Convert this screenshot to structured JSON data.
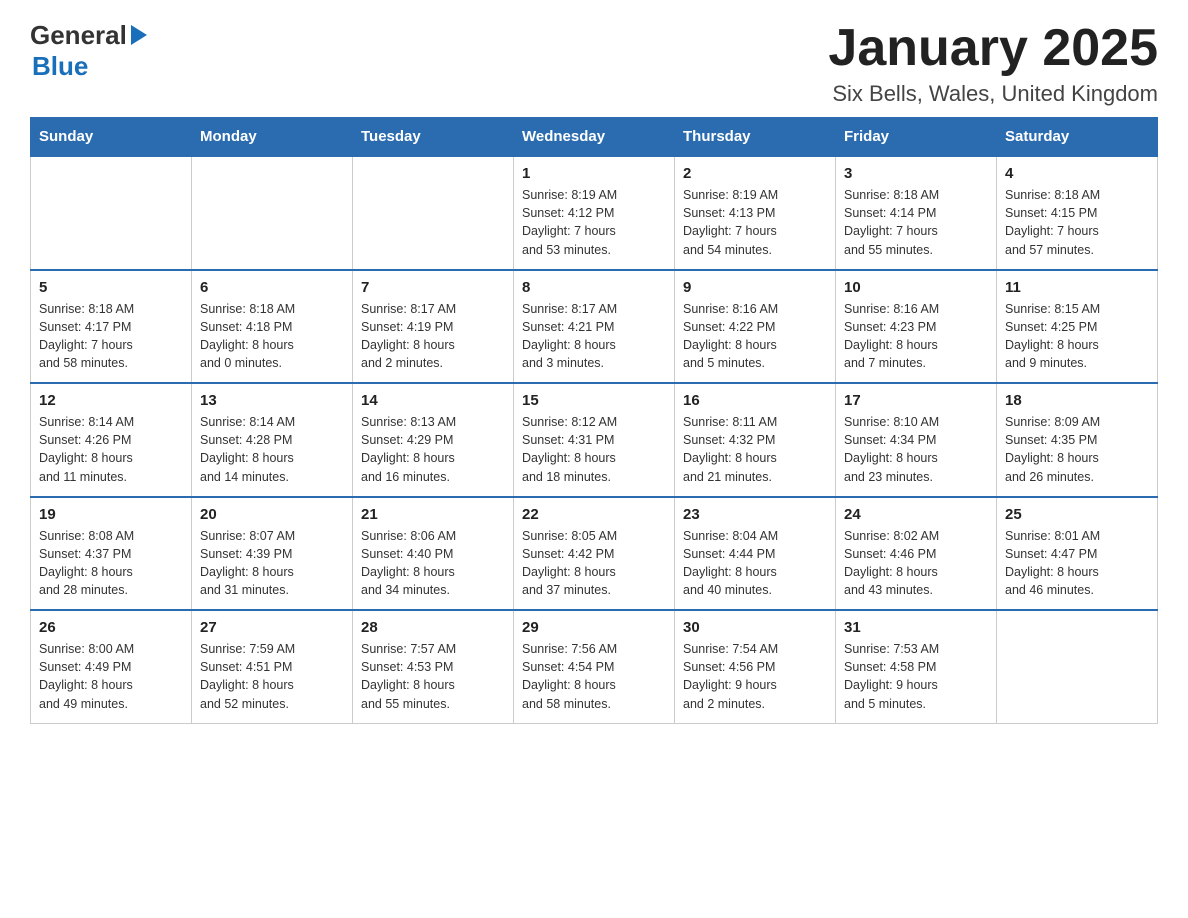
{
  "header": {
    "logo_general": "General",
    "logo_blue": "Blue",
    "title": "January 2025",
    "subtitle": "Six Bells, Wales, United Kingdom"
  },
  "calendar": {
    "days_of_week": [
      "Sunday",
      "Monday",
      "Tuesday",
      "Wednesday",
      "Thursday",
      "Friday",
      "Saturday"
    ],
    "weeks": [
      [
        {
          "day": "",
          "info": ""
        },
        {
          "day": "",
          "info": ""
        },
        {
          "day": "",
          "info": ""
        },
        {
          "day": "1",
          "info": "Sunrise: 8:19 AM\nSunset: 4:12 PM\nDaylight: 7 hours\nand 53 minutes."
        },
        {
          "day": "2",
          "info": "Sunrise: 8:19 AM\nSunset: 4:13 PM\nDaylight: 7 hours\nand 54 minutes."
        },
        {
          "day": "3",
          "info": "Sunrise: 8:18 AM\nSunset: 4:14 PM\nDaylight: 7 hours\nand 55 minutes."
        },
        {
          "day": "4",
          "info": "Sunrise: 8:18 AM\nSunset: 4:15 PM\nDaylight: 7 hours\nand 57 minutes."
        }
      ],
      [
        {
          "day": "5",
          "info": "Sunrise: 8:18 AM\nSunset: 4:17 PM\nDaylight: 7 hours\nand 58 minutes."
        },
        {
          "day": "6",
          "info": "Sunrise: 8:18 AM\nSunset: 4:18 PM\nDaylight: 8 hours\nand 0 minutes."
        },
        {
          "day": "7",
          "info": "Sunrise: 8:17 AM\nSunset: 4:19 PM\nDaylight: 8 hours\nand 2 minutes."
        },
        {
          "day": "8",
          "info": "Sunrise: 8:17 AM\nSunset: 4:21 PM\nDaylight: 8 hours\nand 3 minutes."
        },
        {
          "day": "9",
          "info": "Sunrise: 8:16 AM\nSunset: 4:22 PM\nDaylight: 8 hours\nand 5 minutes."
        },
        {
          "day": "10",
          "info": "Sunrise: 8:16 AM\nSunset: 4:23 PM\nDaylight: 8 hours\nand 7 minutes."
        },
        {
          "day": "11",
          "info": "Sunrise: 8:15 AM\nSunset: 4:25 PM\nDaylight: 8 hours\nand 9 minutes."
        }
      ],
      [
        {
          "day": "12",
          "info": "Sunrise: 8:14 AM\nSunset: 4:26 PM\nDaylight: 8 hours\nand 11 minutes."
        },
        {
          "day": "13",
          "info": "Sunrise: 8:14 AM\nSunset: 4:28 PM\nDaylight: 8 hours\nand 14 minutes."
        },
        {
          "day": "14",
          "info": "Sunrise: 8:13 AM\nSunset: 4:29 PM\nDaylight: 8 hours\nand 16 minutes."
        },
        {
          "day": "15",
          "info": "Sunrise: 8:12 AM\nSunset: 4:31 PM\nDaylight: 8 hours\nand 18 minutes."
        },
        {
          "day": "16",
          "info": "Sunrise: 8:11 AM\nSunset: 4:32 PM\nDaylight: 8 hours\nand 21 minutes."
        },
        {
          "day": "17",
          "info": "Sunrise: 8:10 AM\nSunset: 4:34 PM\nDaylight: 8 hours\nand 23 minutes."
        },
        {
          "day": "18",
          "info": "Sunrise: 8:09 AM\nSunset: 4:35 PM\nDaylight: 8 hours\nand 26 minutes."
        }
      ],
      [
        {
          "day": "19",
          "info": "Sunrise: 8:08 AM\nSunset: 4:37 PM\nDaylight: 8 hours\nand 28 minutes."
        },
        {
          "day": "20",
          "info": "Sunrise: 8:07 AM\nSunset: 4:39 PM\nDaylight: 8 hours\nand 31 minutes."
        },
        {
          "day": "21",
          "info": "Sunrise: 8:06 AM\nSunset: 4:40 PM\nDaylight: 8 hours\nand 34 minutes."
        },
        {
          "day": "22",
          "info": "Sunrise: 8:05 AM\nSunset: 4:42 PM\nDaylight: 8 hours\nand 37 minutes."
        },
        {
          "day": "23",
          "info": "Sunrise: 8:04 AM\nSunset: 4:44 PM\nDaylight: 8 hours\nand 40 minutes."
        },
        {
          "day": "24",
          "info": "Sunrise: 8:02 AM\nSunset: 4:46 PM\nDaylight: 8 hours\nand 43 minutes."
        },
        {
          "day": "25",
          "info": "Sunrise: 8:01 AM\nSunset: 4:47 PM\nDaylight: 8 hours\nand 46 minutes."
        }
      ],
      [
        {
          "day": "26",
          "info": "Sunrise: 8:00 AM\nSunset: 4:49 PM\nDaylight: 8 hours\nand 49 minutes."
        },
        {
          "day": "27",
          "info": "Sunrise: 7:59 AM\nSunset: 4:51 PM\nDaylight: 8 hours\nand 52 minutes."
        },
        {
          "day": "28",
          "info": "Sunrise: 7:57 AM\nSunset: 4:53 PM\nDaylight: 8 hours\nand 55 minutes."
        },
        {
          "day": "29",
          "info": "Sunrise: 7:56 AM\nSunset: 4:54 PM\nDaylight: 8 hours\nand 58 minutes."
        },
        {
          "day": "30",
          "info": "Sunrise: 7:54 AM\nSunset: 4:56 PM\nDaylight: 9 hours\nand 2 minutes."
        },
        {
          "day": "31",
          "info": "Sunrise: 7:53 AM\nSunset: 4:58 PM\nDaylight: 9 hours\nand 5 minutes."
        },
        {
          "day": "",
          "info": ""
        }
      ]
    ]
  }
}
